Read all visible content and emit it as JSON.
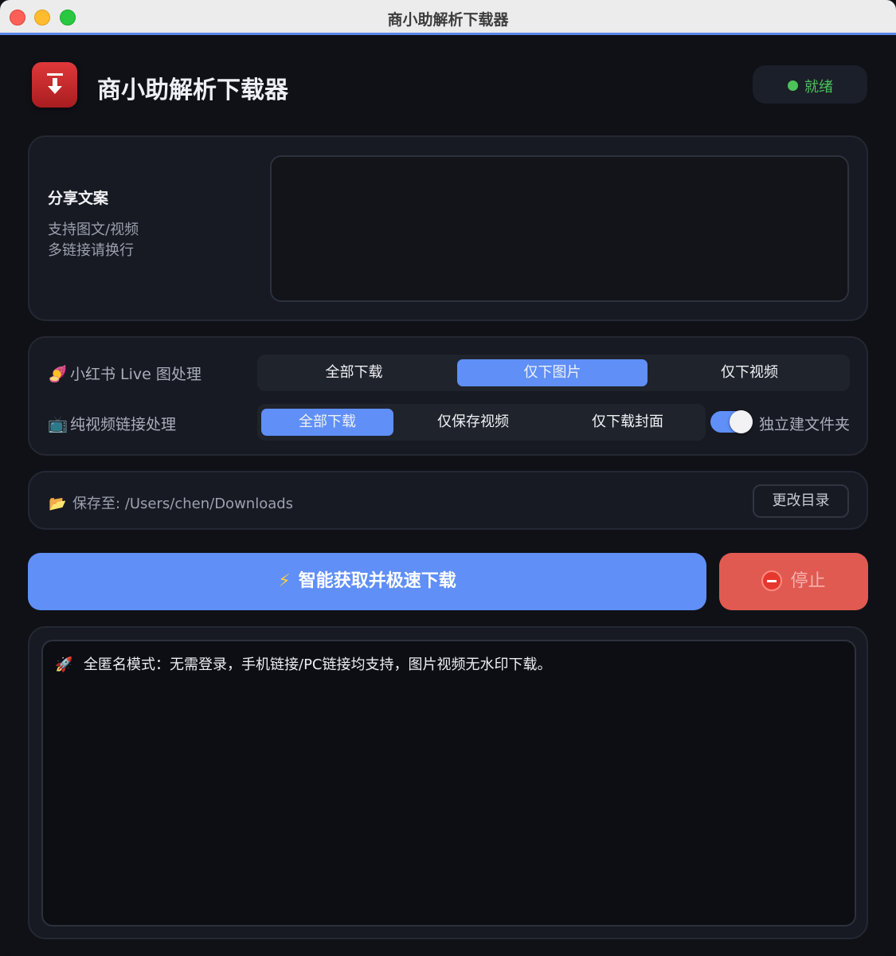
{
  "window": {
    "title": "商小助解析下载器"
  },
  "header": {
    "app_title": "商小助解析下载器",
    "logo_icon": "download-arrow-icon",
    "status": {
      "text": "就绪",
      "color": "#4cc25a"
    }
  },
  "share": {
    "label": "分享文案",
    "hint_line1": "支持图文/视频",
    "hint_line2": "多链接请换行",
    "input_value": ""
  },
  "options": {
    "xhs_live": {
      "icon": "sweet-potato-emoji",
      "label": "小红书 Live 图处理",
      "choices": [
        "全部下载",
        "仅下图片",
        "仅下视频"
      ],
      "selected": "仅下图片"
    },
    "video_link": {
      "icon": "tv-emoji",
      "label": "纯视频链接处理",
      "choices": [
        "全部下载",
        "仅保存视频",
        "仅下载封面"
      ],
      "selected": "全部下载"
    },
    "separate_folder": {
      "label": "独立建文件夹",
      "on": true
    }
  },
  "save_path": {
    "icon": "folder-emoji",
    "prefix": "保存至:",
    "path": "/Users/chen/Downloads",
    "change_label": "更改目录"
  },
  "actions": {
    "main_label": "智能获取并极速下载",
    "main_icon": "lightning-icon",
    "stop_label": "停止",
    "stop_icon": "stop-sign-icon"
  },
  "log": {
    "lines": [
      {
        "icon": "rocket-emoji",
        "text": "全匿名模式：无需登录，手机链接/PC链接均支持，图片视频无水印下载。"
      }
    ]
  },
  "colors": {
    "accent": "#5f8ff7",
    "danger": "#e05a52",
    "background": "#0f1117",
    "card": "#171a22"
  }
}
